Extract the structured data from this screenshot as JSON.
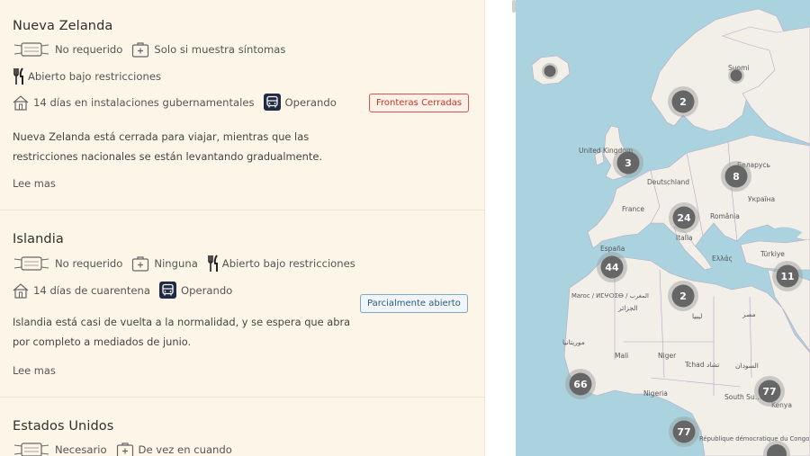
{
  "cards": [
    {
      "title": "Nueva Zelanda",
      "mask": "No requerido",
      "test": "Solo si muestra síntomas",
      "restaurants": "Abierto bajo restricciones",
      "quarantine": "14 días en instalaciones gubernamentales",
      "transport": "Operando",
      "badge": "Fronteras Cerradas",
      "description": "Nueva Zelanda está cerrada para viajar, mientras que las restricciones nacionales se están levantando gradualmente.",
      "more": "Lee mas"
    },
    {
      "title": "Islandia",
      "mask": "No requerido",
      "test": "Ninguna",
      "restaurants": "Abierto bajo restricciones",
      "quarantine": "14 días de cuarentena",
      "transport": "Operando",
      "badge": "Parcialmente abierto",
      "description": "Islandia está casi de vuelta a la normalidad, y se espera que abra por completo a mediados de junio.",
      "more": "Lee mas"
    },
    {
      "title": "Estados Unidos",
      "mask": "Necesario",
      "test": "De vez en cuando"
    }
  ],
  "map": {
    "clusters": [
      "2",
      "3",
      "8",
      "24",
      "44",
      "2",
      "11",
      "66",
      "77",
      "77"
    ],
    "labels": [
      "United Kingdom",
      "Deutschland",
      "France",
      "Україна",
      "România",
      "España",
      "Italia",
      "Türkiye",
      "Ελλάς",
      "Maroc / ⵍⵎⵖⵔⵉⴱ / المغرب",
      "الجزائر",
      "ليبيا",
      "مصر",
      "موريتانيا",
      "Mali",
      "Niger",
      "Tchad تشاد",
      "السودان",
      "Nigeria",
      "South Su…",
      "Kenya",
      "République démocratique du Congo",
      "Suomi",
      "Беларусь"
    ]
  }
}
